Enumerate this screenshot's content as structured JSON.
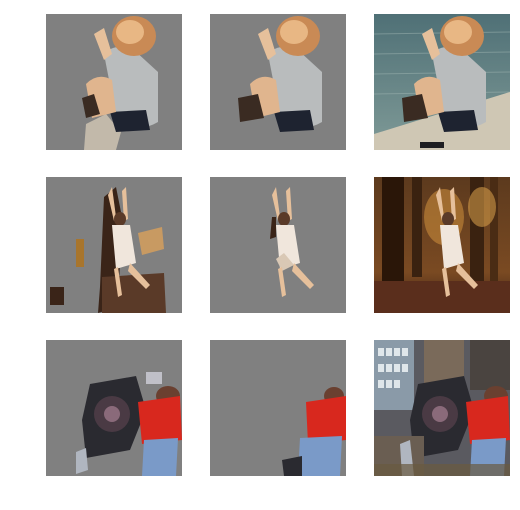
{
  "colors": {
    "mask_gray": "#808080",
    "background": "#ffffff"
  },
  "rows": [
    {
      "subject": "seated-girl",
      "cells": [
        {
          "type": "masked-loose"
        },
        {
          "type": "masked-tight"
        },
        {
          "type": "original-photo"
        }
      ]
    },
    {
      "subject": "hanging-girl-forest",
      "cells": [
        {
          "type": "masked-loose"
        },
        {
          "type": "masked-tight"
        },
        {
          "type": "original-photo"
        }
      ]
    },
    {
      "subject": "mechanic-red-shirt",
      "cells": [
        {
          "type": "masked-loose"
        },
        {
          "type": "masked-tight"
        },
        {
          "type": "original-photo"
        }
      ]
    }
  ]
}
